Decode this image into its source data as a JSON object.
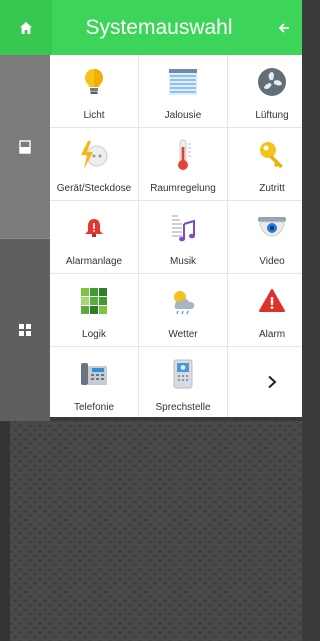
{
  "header": {
    "title": "Systemauswahl",
    "home_icon": "home-icon",
    "back_icon": "arrow-left-icon"
  },
  "sidebar": {
    "items": [
      {
        "icon": "single-device-icon",
        "active": true
      },
      {
        "icon": "grid-icon",
        "active": false
      }
    ]
  },
  "tiles": [
    {
      "label": "Licht",
      "icon": "lightbulb-icon"
    },
    {
      "label": "Jalousie",
      "icon": "blind-icon"
    },
    {
      "label": "Lüftung",
      "icon": "fan-icon"
    },
    {
      "label": "Gerät/Steckdose",
      "icon": "plug-socket-icon"
    },
    {
      "label": "Raumregelung",
      "icon": "thermometer-icon"
    },
    {
      "label": "Zutritt",
      "icon": "key-icon"
    },
    {
      "label": "Alarmanlage",
      "icon": "alarm-bell-icon"
    },
    {
      "label": "Musik",
      "icon": "music-note-icon"
    },
    {
      "label": "Video",
      "icon": "security-camera-icon"
    },
    {
      "label": "Logik",
      "icon": "logic-blocks-icon"
    },
    {
      "label": "Wetter",
      "icon": "weather-icon"
    },
    {
      "label": "Alarm",
      "icon": "warning-icon"
    },
    {
      "label": "Telefonie",
      "icon": "desk-phone-icon"
    },
    {
      "label": "Sprechstelle",
      "icon": "intercom-icon"
    },
    {
      "label": "",
      "icon": "chevron-right-icon"
    }
  ],
  "colors": {
    "accent": "#3cd55a",
    "sidebar": "#5f5f5f",
    "background": "#3d3d3d"
  }
}
